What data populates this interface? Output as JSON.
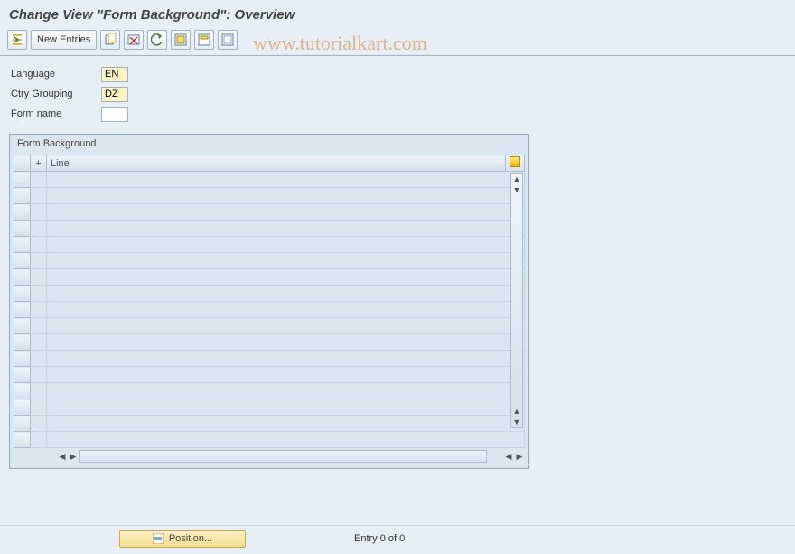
{
  "header": {
    "title": "Change View \"Form Background\": Overview"
  },
  "toolbar": {
    "new_entries_label": "New Entries"
  },
  "fields": {
    "language": {
      "label": "Language",
      "value": "EN"
    },
    "ctry_grouping": {
      "label": "Ctry Grouping",
      "value": "DZ"
    },
    "form_name": {
      "label": "Form name",
      "value": ""
    }
  },
  "panel": {
    "title": "Form Background",
    "columns": {
      "plus": "+",
      "line": "Line"
    }
  },
  "footer": {
    "position_label": "Position...",
    "entry_text": "Entry 0 of 0"
  },
  "watermark": "www.tutorialkart.com"
}
